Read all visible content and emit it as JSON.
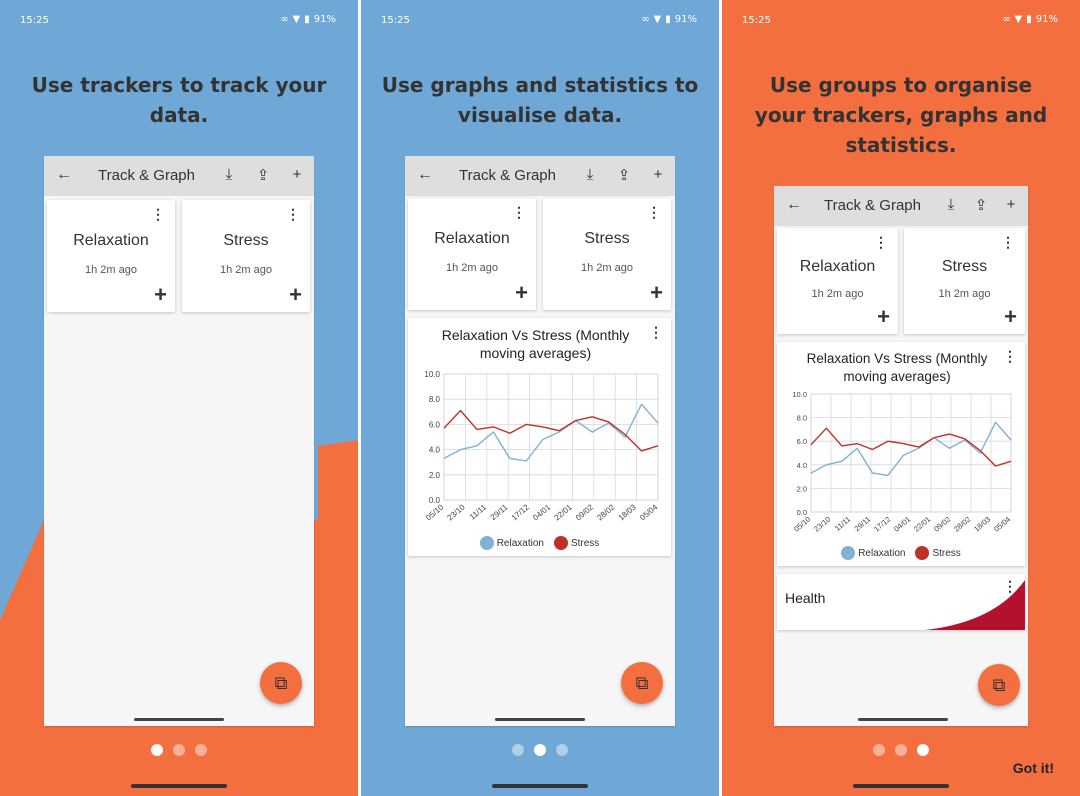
{
  "status_bar": {
    "time": "15:25",
    "battery": "91%"
  },
  "app": {
    "title": "Track & Graph",
    "back_icon": "arrow-left-icon",
    "action_icons": [
      "download-icon",
      "upload-icon",
      "plus-icon"
    ]
  },
  "colors": {
    "blue_bg": "#6fa8d6",
    "orange_bg": "#f46f3f",
    "relaxation": "#7fb3d1",
    "stress": "#c0302a",
    "health_accent": "#b3112e"
  },
  "screens": [
    {
      "headline": "Use trackers to track your data."
    },
    {
      "headline": "Use graphs and statistics to visualise data."
    },
    {
      "headline": "Use groups to organise your trackers, graphs and statistics."
    }
  ],
  "trackers": [
    {
      "name": "Relaxation",
      "last": "1h 2m ago"
    },
    {
      "name": "Stress",
      "last": "1h 2m ago"
    }
  ],
  "graph": {
    "title": "Relaxation Vs Stress (Monthly moving averages)"
  },
  "group": {
    "name": "Health"
  },
  "onboarding": {
    "done_label": "Got it!",
    "page_count": 3
  },
  "chart_data": {
    "type": "line",
    "title": "Relaxation Vs Stress (Monthly moving averages)",
    "xlabel": "",
    "ylabel": "",
    "ylim": [
      0,
      10
    ],
    "yticks": [
      "0.0",
      "2.0",
      "4.0",
      "6.0",
      "8.0",
      "10.0"
    ],
    "x": [
      "05/10",
      "23/10",
      "11/11",
      "29/11",
      "17/12",
      "04/01",
      "22/01",
      "09/02",
      "28/02",
      "18/03",
      "05/04"
    ],
    "series": [
      {
        "name": "Relaxation",
        "color": "#7fb3d1",
        "values": [
          3.3,
          4.0,
          4.3,
          5.4,
          3.3,
          3.1,
          4.8,
          5.4,
          6.3,
          5.4,
          6.1,
          5.0,
          7.6,
          6.1
        ]
      },
      {
        "name": "Stress",
        "color": "#c0302a",
        "values": [
          5.7,
          7.1,
          5.6,
          5.8,
          5.3,
          6.0,
          5.8,
          5.5,
          6.3,
          6.6,
          6.2,
          5.2,
          3.9,
          4.3
        ]
      }
    ],
    "grid": true,
    "legend": "bottom"
  }
}
